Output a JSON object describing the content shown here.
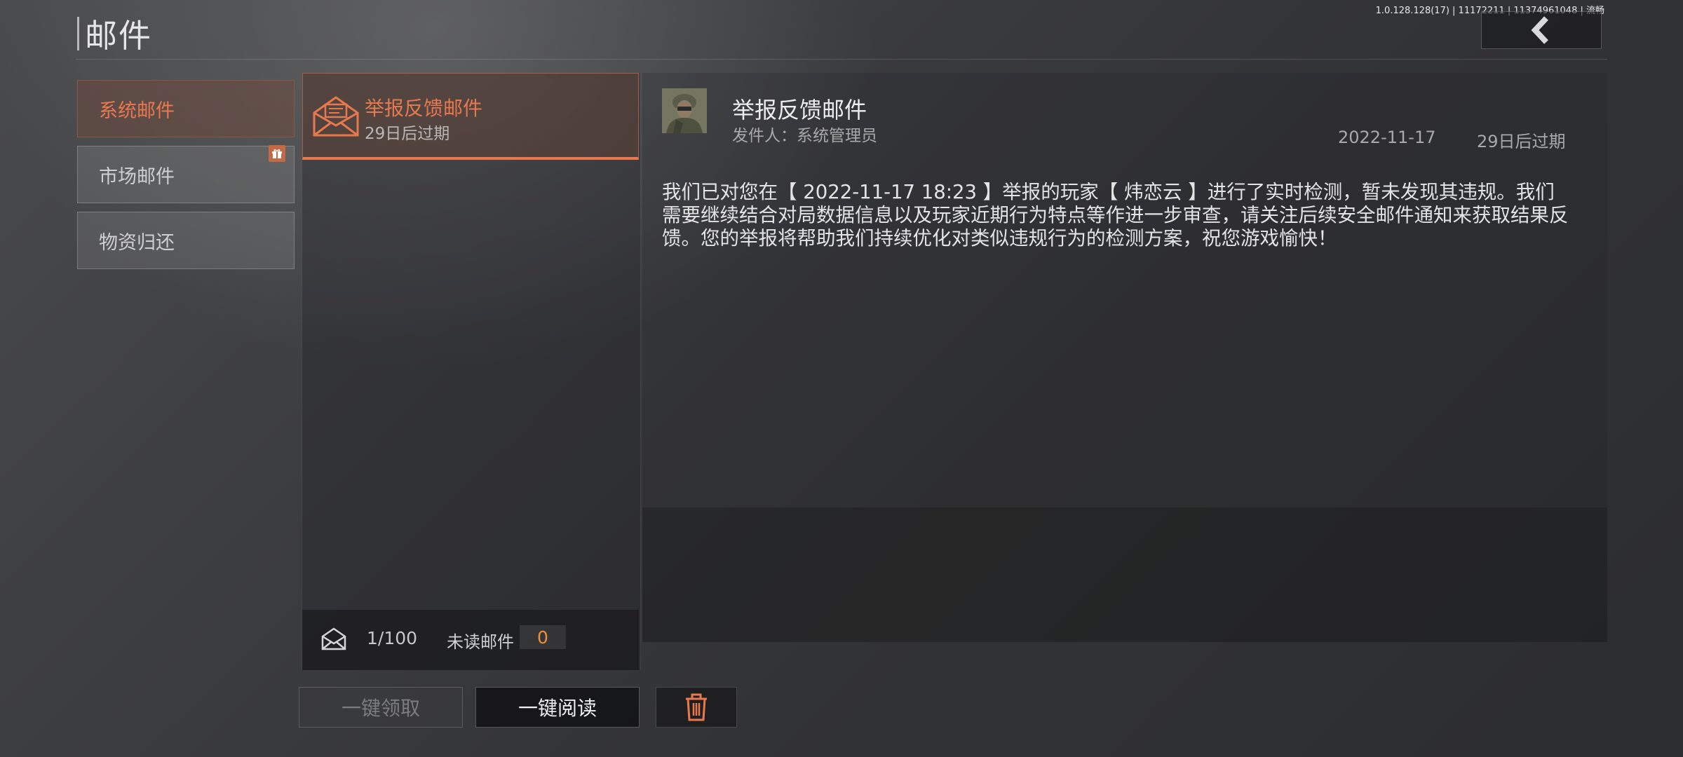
{
  "header": {
    "title": "邮件",
    "version": "1.0.128.128(17) | 11172211 | 11374961048 | 流畅"
  },
  "categories": [
    {
      "label": "系统邮件",
      "active": true
    },
    {
      "label": "市场邮件",
      "active": false
    },
    {
      "label": "物资归还",
      "active": false
    }
  ],
  "mail_list": [
    {
      "title": "举报反馈邮件",
      "expire": "29日后过期",
      "selected": true
    }
  ],
  "stats": {
    "count": "1/100",
    "unread_label": "未读邮件",
    "unread_value": "0"
  },
  "buttons": {
    "claim_all": "一键领取",
    "read_all": "一键阅读",
    "delete": "trash-icon"
  },
  "detail": {
    "title": "举报反馈邮件",
    "sender_label": "发件人：",
    "sender_name": "系统管理员",
    "date": "2022-11-17",
    "expire": "29日后过期",
    "body": "我们已对您在【 2022-11-17 18:23 】举报的玩家【 炜恋云 】进行了实时检测，暂未发现其违规。我们需要继续结合对局数据信息以及玩家近期行为特点等作进一步审查，请关注后续安全邮件通知来获取结果反馈。您的举报将帮助我们持续优化对类似违规行为的检测方案，祝您游戏愉快！"
  },
  "colors": {
    "accent": "#e8794f",
    "unread_value": "#f08d3a"
  }
}
